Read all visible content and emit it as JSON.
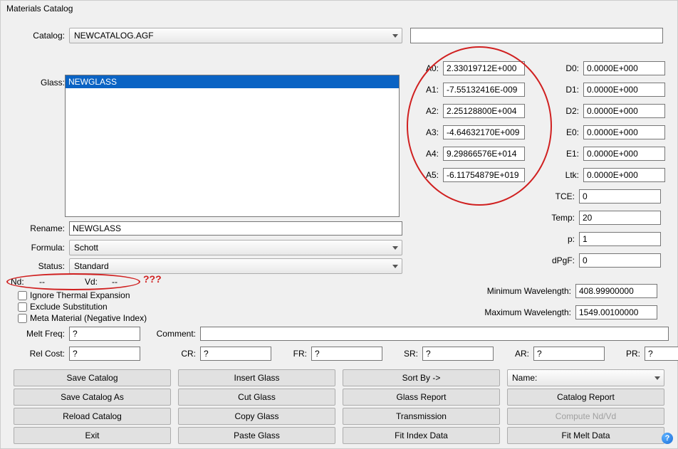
{
  "window_title": "Materials Catalog",
  "labels": {
    "catalog": "Catalog:",
    "glass": "Glass:",
    "rename": "Rename:",
    "formula": "Formula:",
    "status": "Status:",
    "nd": "Nd:",
    "vd": "Vd:",
    "ignore_thermal": "Ignore Thermal Expansion",
    "exclude_sub": "Exclude Substitution",
    "meta_mat": "Meta Material (Negative Index)",
    "melt_freq": "Melt Freq:",
    "comment": "Comment:",
    "rel_cost": "Rel Cost:",
    "cr": "CR:",
    "fr": "FR:",
    "sr": "SR:",
    "ar": "AR:",
    "pr": "PR:",
    "min_wave": "Minimum Wavelength:",
    "max_wave": "Maximum Wavelength:"
  },
  "catalog_value": "NEWCATALOG.AGF",
  "search_value": "",
  "glass_list": [
    "NEWGLASS"
  ],
  "rename_value": "NEWGLASS",
  "formula_value": "Schott",
  "status_value": "Standard",
  "nd_value": "--",
  "vd_value": "--",
  "annotation_q": "???",
  "melt_freq_value": "?",
  "comment_value": "",
  "rel_cost_value": "?",
  "cr_value": "?",
  "fr_value": "?",
  "sr_value": "?",
  "ar_value": "?",
  "pr_value": "?",
  "coeffs": {
    "A0": {
      "label": "A0:",
      "value": "2.33019712E+000"
    },
    "A1": {
      "label": "A1:",
      "value": "-7.55132416E-009"
    },
    "A2": {
      "label": "A2:",
      "value": "2.25128800E+004"
    },
    "A3": {
      "label": "A3:",
      "value": "-4.64632170E+009"
    },
    "A4": {
      "label": "A4:",
      "value": "9.29866576E+014"
    },
    "A5": {
      "label": "A5:",
      "value": "-6.11754879E+019"
    }
  },
  "right": {
    "D0": {
      "label": "D0:",
      "value": "0.0000E+000"
    },
    "D1": {
      "label": "D1:",
      "value": "0.0000E+000"
    },
    "D2": {
      "label": "D2:",
      "value": "0.0000E+000"
    },
    "E0": {
      "label": "E0:",
      "value": "0.0000E+000"
    },
    "E1": {
      "label": "E1:",
      "value": "0.0000E+000"
    },
    "Ltk": {
      "label": "Ltk:",
      "value": "0.0000E+000"
    },
    "TCE": {
      "label": "TCE:",
      "value": "0"
    },
    "Temp": {
      "label": "Temp:",
      "value": "20"
    },
    "p": {
      "label": "p:",
      "value": "1"
    },
    "dPgF": {
      "label": "dPgF:",
      "value": "0"
    }
  },
  "min_wave_value": "408.99900000",
  "max_wave_value": "1549.00100000",
  "buttons": {
    "save_catalog": "Save Catalog",
    "insert_glass": "Insert Glass",
    "sort_by": "Sort By ->",
    "sort_key": "Name:",
    "save_catalog_as": "Save Catalog As",
    "cut_glass": "Cut Glass",
    "glass_report": "Glass Report",
    "catalog_report": "Catalog Report",
    "reload_catalog": "Reload Catalog",
    "copy_glass": "Copy Glass",
    "transmission": "Transmission",
    "compute": "Compute Nd/Vd",
    "exit": "Exit",
    "paste_glass": "Paste Glass",
    "fit_index": "Fit Index Data",
    "fit_melt": "Fit Melt Data"
  }
}
